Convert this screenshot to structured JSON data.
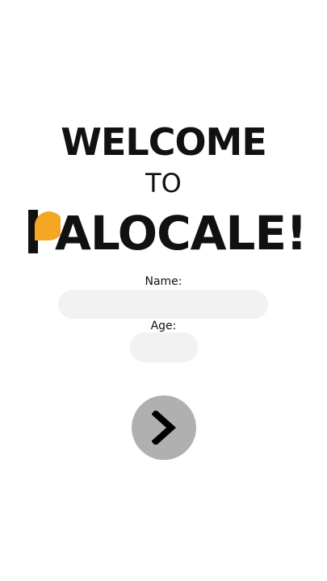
{
  "header": {
    "welcome": "WELCOME",
    "to": "TO",
    "brand_text": "ALOCALE!"
  },
  "form": {
    "name_label": "Name:",
    "name_value": "",
    "age_label": "Age:",
    "age_value": ""
  },
  "next_button": {
    "icon": "chevron-right-icon"
  },
  "colors": {
    "background": "#ffffff",
    "text": "#111111",
    "brand_accent": "#f5a623",
    "input_bg": "#f2f2f2",
    "button_bg": "#b0b0b0"
  }
}
